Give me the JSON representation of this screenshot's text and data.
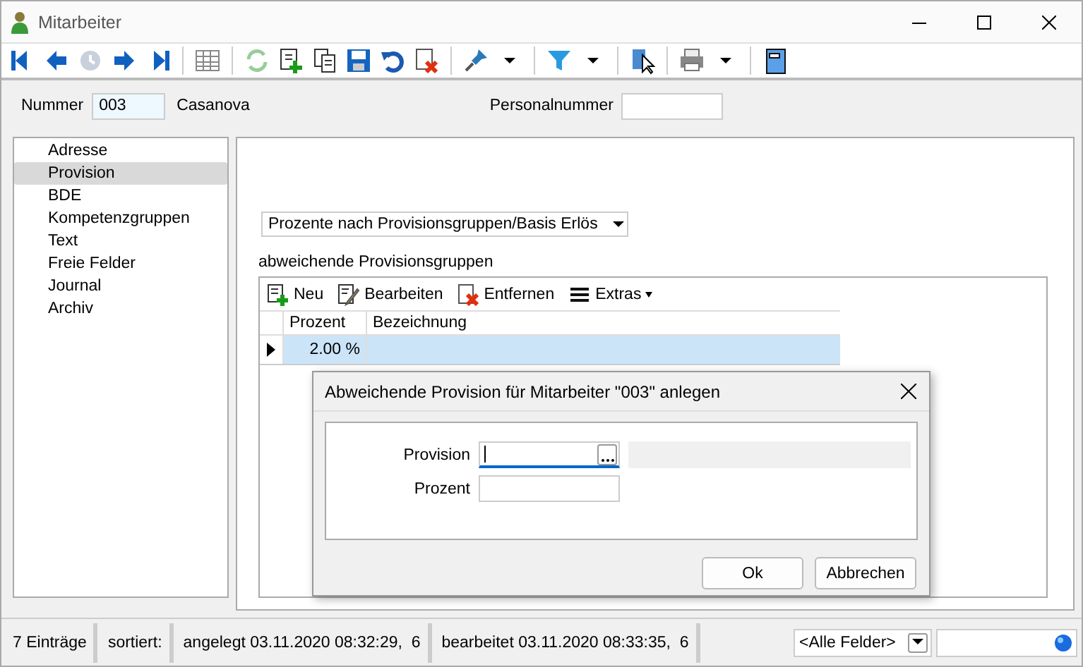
{
  "window": {
    "title": "Mitarbeiter"
  },
  "header": {
    "nummer_label": "Nummer",
    "nummer_value": "003",
    "name": "Casanova",
    "personalnummer_label": "Personalnummer"
  },
  "sidebar": {
    "items": [
      {
        "label": "Adresse",
        "selected": false
      },
      {
        "label": "Provision",
        "selected": true
      },
      {
        "label": "BDE",
        "selected": false
      },
      {
        "label": "Kompetenzgruppen",
        "selected": false
      },
      {
        "label": "Text",
        "selected": false
      },
      {
        "label": "Freie Felder",
        "selected": false
      },
      {
        "label": "Journal",
        "selected": false
      },
      {
        "label": "Archiv",
        "selected": false
      }
    ]
  },
  "provision": {
    "mode": "Prozente nach Provisionsgruppen/Basis Erlös",
    "group_label": "abweichende Provisionsgruppen",
    "grid_toolbar": [
      {
        "kind": "new",
        "label": "Neu"
      },
      {
        "kind": "edit",
        "label": "Bearbeiten"
      },
      {
        "kind": "delete",
        "label": "Entfernen"
      },
      {
        "kind": "menu",
        "label": "Extras"
      }
    ],
    "columns": [
      "Prozent",
      "Bezeichnung"
    ],
    "rows": [
      {
        "prozent": "2.00 %",
        "selected": true
      }
    ]
  },
  "dialog": {
    "title": "Abweichende Provision für Mitarbeiter \"003\" anlegen",
    "fields": [
      {
        "kind": "lookup",
        "label": "Provision",
        "focused": true
      },
      {
        "kind": "text",
        "label": "Prozent",
        "focused": false
      }
    ],
    "buttons": [
      "Ok",
      "Abbrechen"
    ]
  },
  "status_bar": {
    "sections": [
      "7 Einträge",
      "sortiert:",
      "angelegt 03.11.2020 08:32:29,  6",
      "bearbeitet 03.11.2020 08:33:35,  6"
    ],
    "filter": "<Alle Felder>"
  }
}
